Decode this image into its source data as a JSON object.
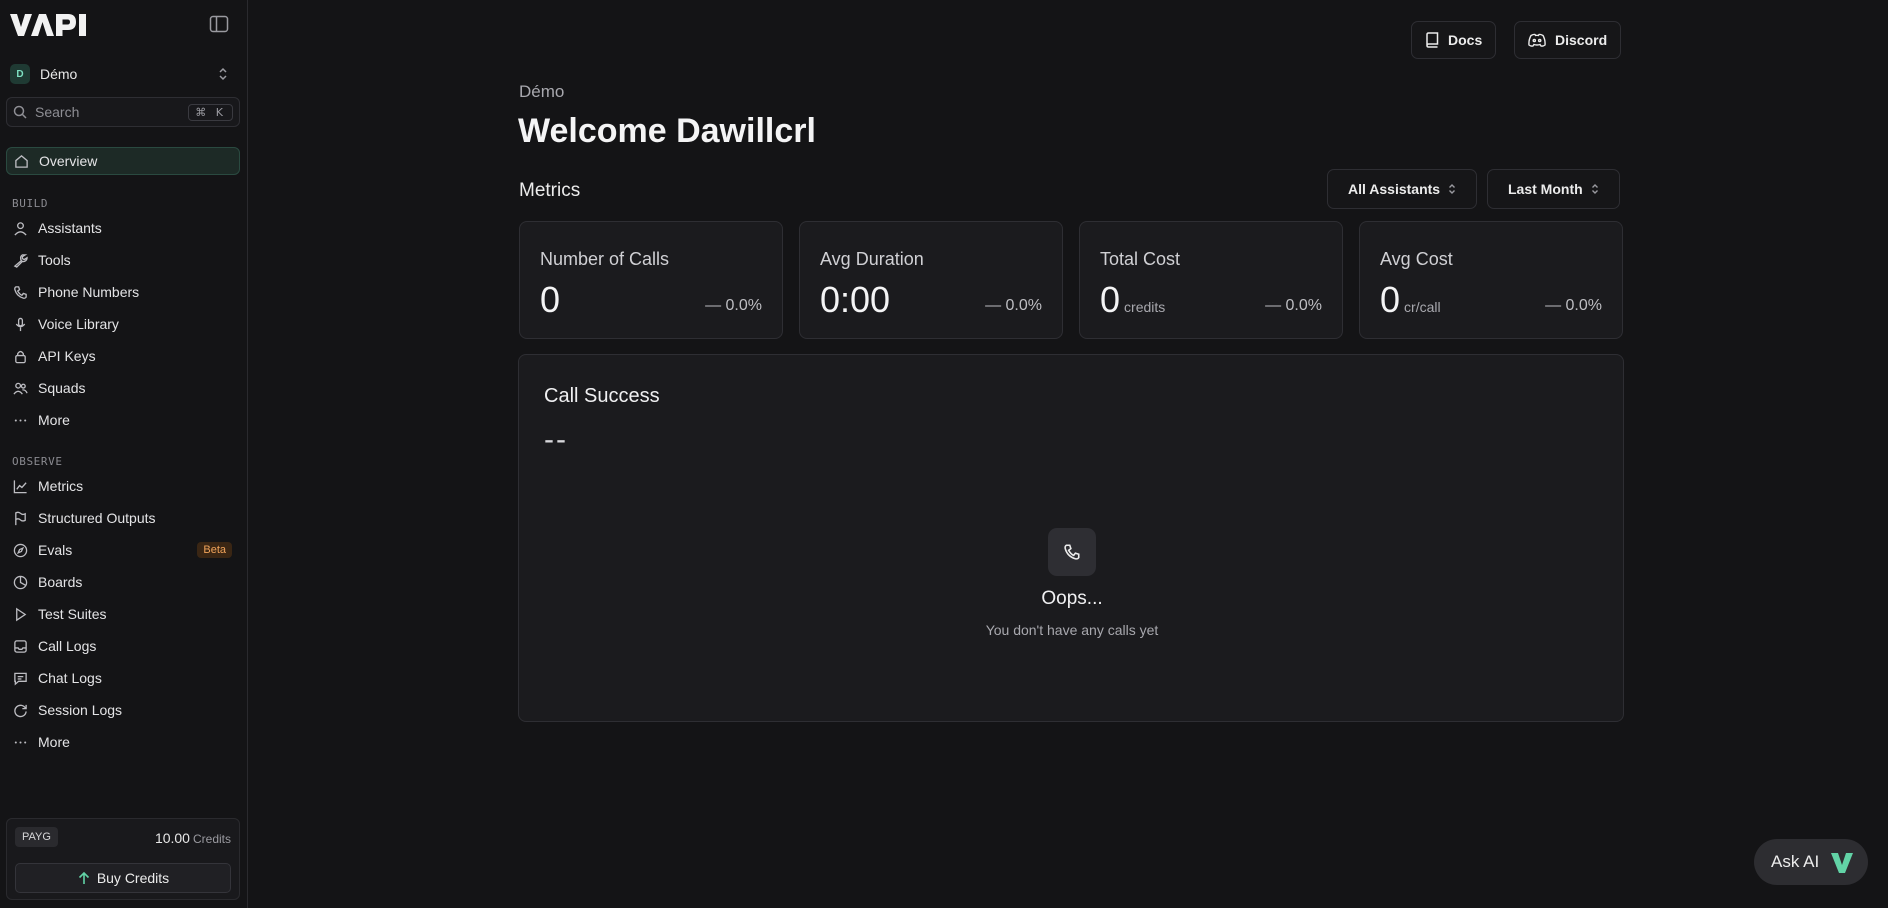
{
  "app": {
    "logo_text": "VAPI",
    "accent_color": "#62d3a6"
  },
  "org": {
    "initial": "D",
    "name": "Démo"
  },
  "search": {
    "placeholder": "Search",
    "shortcut": "⌘ K"
  },
  "sidebar": {
    "overview": "Overview",
    "build_label": "BUILD",
    "build_items": [
      {
        "label": "Assistants",
        "icon": "user-icon"
      },
      {
        "label": "Tools",
        "icon": "wrench-icon"
      },
      {
        "label": "Phone Numbers",
        "icon": "phone-icon"
      },
      {
        "label": "Voice Library",
        "icon": "mic-icon"
      },
      {
        "label": "API Keys",
        "icon": "lock-icon"
      },
      {
        "label": "Squads",
        "icon": "users-icon"
      },
      {
        "label": "More",
        "icon": "ellipsis-icon"
      }
    ],
    "observe_label": "OBSERVE",
    "observe_items": [
      {
        "label": "Metrics",
        "icon": "chart-line-icon"
      },
      {
        "label": "Structured Outputs",
        "icon": "flag-icon"
      },
      {
        "label": "Evals",
        "icon": "compass-icon",
        "badge": "Beta"
      },
      {
        "label": "Boards",
        "icon": "circle-icon"
      },
      {
        "label": "Test Suites",
        "icon": "play-icon"
      },
      {
        "label": "Call Logs",
        "icon": "inbox-icon"
      },
      {
        "label": "Chat Logs",
        "icon": "message-icon"
      },
      {
        "label": "Session Logs",
        "icon": "refresh-icon"
      },
      {
        "label": "More",
        "icon": "ellipsis-icon"
      }
    ]
  },
  "billing": {
    "plan": "PAYG",
    "amount": "10.00",
    "unit": "Credits",
    "buy_label": "Buy Credits"
  },
  "header": {
    "docs_label": "Docs",
    "discord_label": "Discord"
  },
  "main": {
    "breadcrumb": "Démo",
    "welcome": "Welcome Dawillcrl",
    "metrics_title": "Metrics",
    "assistant_filter": "All Assistants",
    "period_filter": "Last Month",
    "cards": [
      {
        "label": "Number of Calls",
        "value": "0",
        "unit": "",
        "delta": "— 0.0%"
      },
      {
        "label": "Avg Duration",
        "value": "0:00",
        "unit": "",
        "delta": "— 0.0%"
      },
      {
        "label": "Total Cost",
        "value": "0",
        "unit": "credits",
        "delta": "— 0.0%"
      },
      {
        "label": "Avg Cost",
        "value": "0",
        "unit": "cr/call",
        "delta": "— 0.0%"
      }
    ],
    "call_success": {
      "title": "Call Success",
      "value": "--",
      "empty_title": "Oops...",
      "empty_message": "You don't have any calls yet"
    }
  },
  "ask_ai": {
    "label": "Ask AI"
  }
}
